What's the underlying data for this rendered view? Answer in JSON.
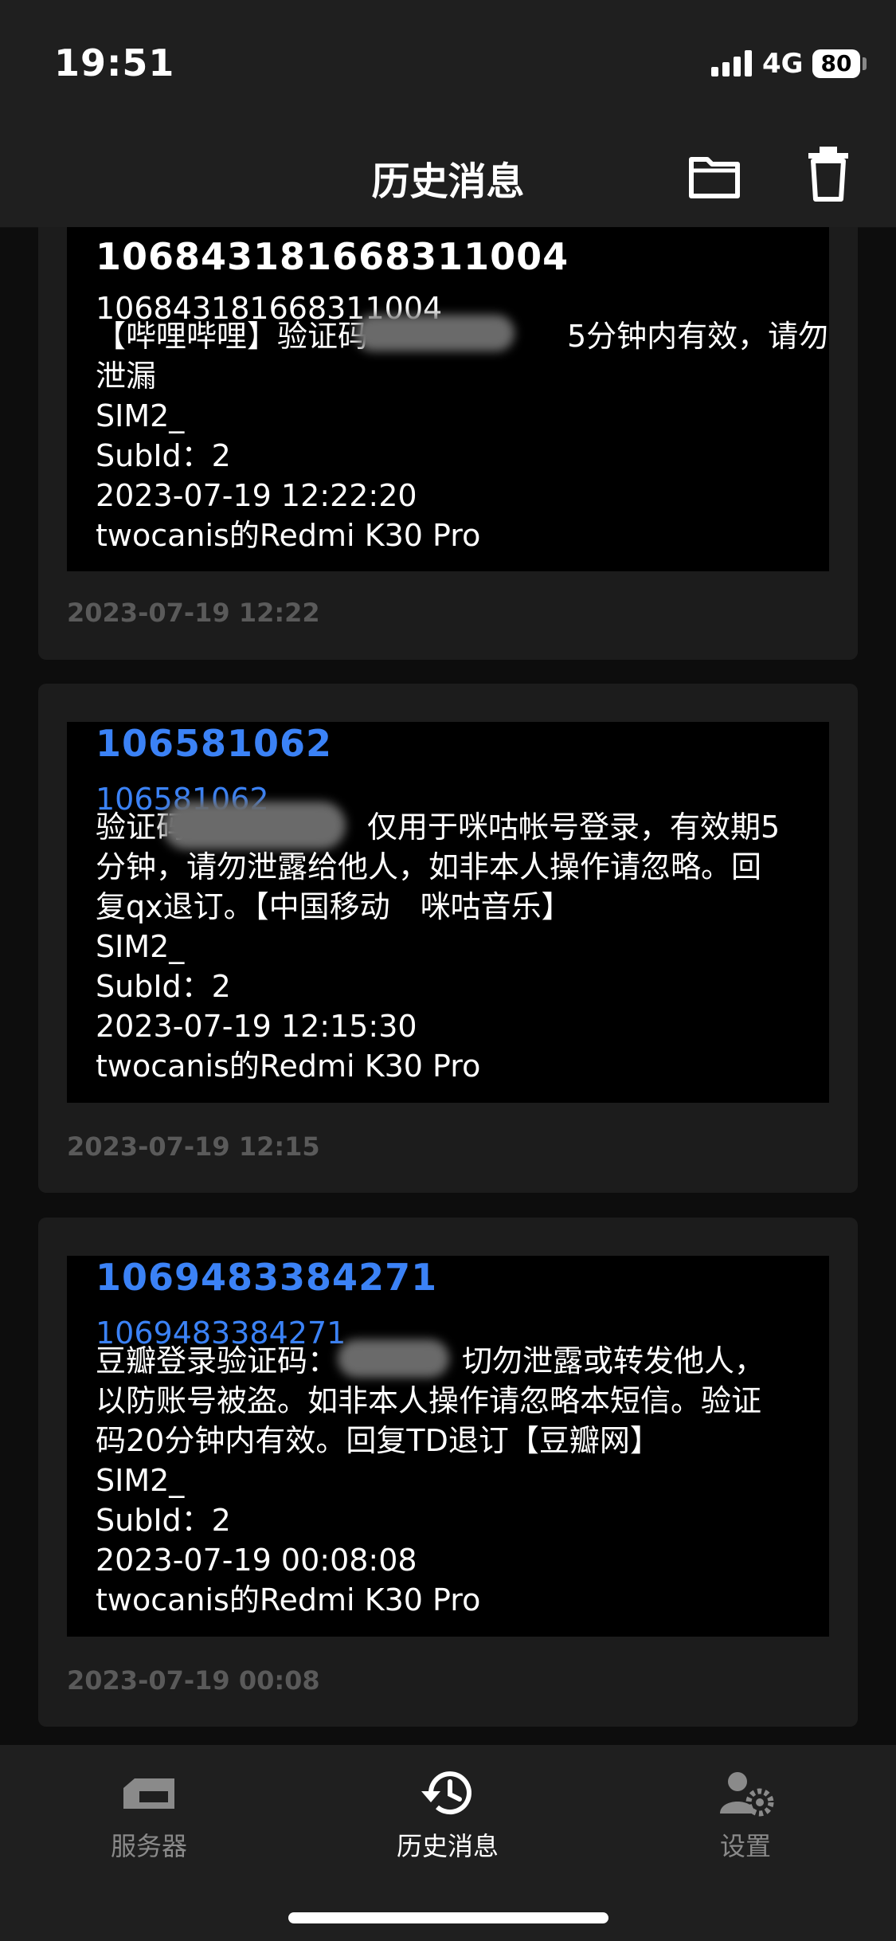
{
  "status_bar": {
    "time": "19:51",
    "network": "4G",
    "battery": "80"
  },
  "header": {
    "title": "历史消息"
  },
  "messages": [
    {
      "title": "106843181668311004",
      "title_color": "#ffffff",
      "sender_line": "106843181668311004",
      "body_lines": [
        "【哔哩哔哩】验证码",
        "5分钟内有效，请勿",
        "泄漏"
      ],
      "sim": "SIM2_",
      "subid": "SubId：2",
      "datetime": "2023-07-19 12:22:20",
      "device": "twocanis的Redmi K30 Pro",
      "time": "2023-07-19 12:22"
    },
    {
      "title": "106581062",
      "title_color": "#3b82f6",
      "sender_line": "106581062",
      "body_lines": [
        "验证码",
        "仅用于咪咕帐号登录，有效期5",
        "分钟，请勿泄露给他人，如非本人操作请忽略。回",
        "复qx退订。【中国移动　咪咕音乐】"
      ],
      "sim": "SIM2_",
      "subid": "SubId：2",
      "datetime": "2023-07-19 12:15:30",
      "device": "twocanis的Redmi K30 Pro",
      "time": "2023-07-19 12:15"
    },
    {
      "title": "1069483384271",
      "title_color": "#3b82f6",
      "sender_line": "1069483384271",
      "body_lines": [
        "豆瓣登录验证码：",
        "切勿泄露或转发他人，",
        "以防账号被盗。如非本人操作请忽略本短信。验证",
        "码20分钟内有效。回复TD退订【豆瓣网】"
      ],
      "sim": "SIM2_",
      "subid": "SubId：2",
      "datetime": "2023-07-19 00:08:08",
      "device": "twocanis的Redmi K30 Pro",
      "time": "2023-07-19 00:08"
    }
  ],
  "tabbar": {
    "items": [
      {
        "label": "服务器",
        "icon": "server-icon"
      },
      {
        "label": "历史消息",
        "icon": "history-icon"
      },
      {
        "label": "设置",
        "icon": "settings-icon"
      }
    ]
  }
}
